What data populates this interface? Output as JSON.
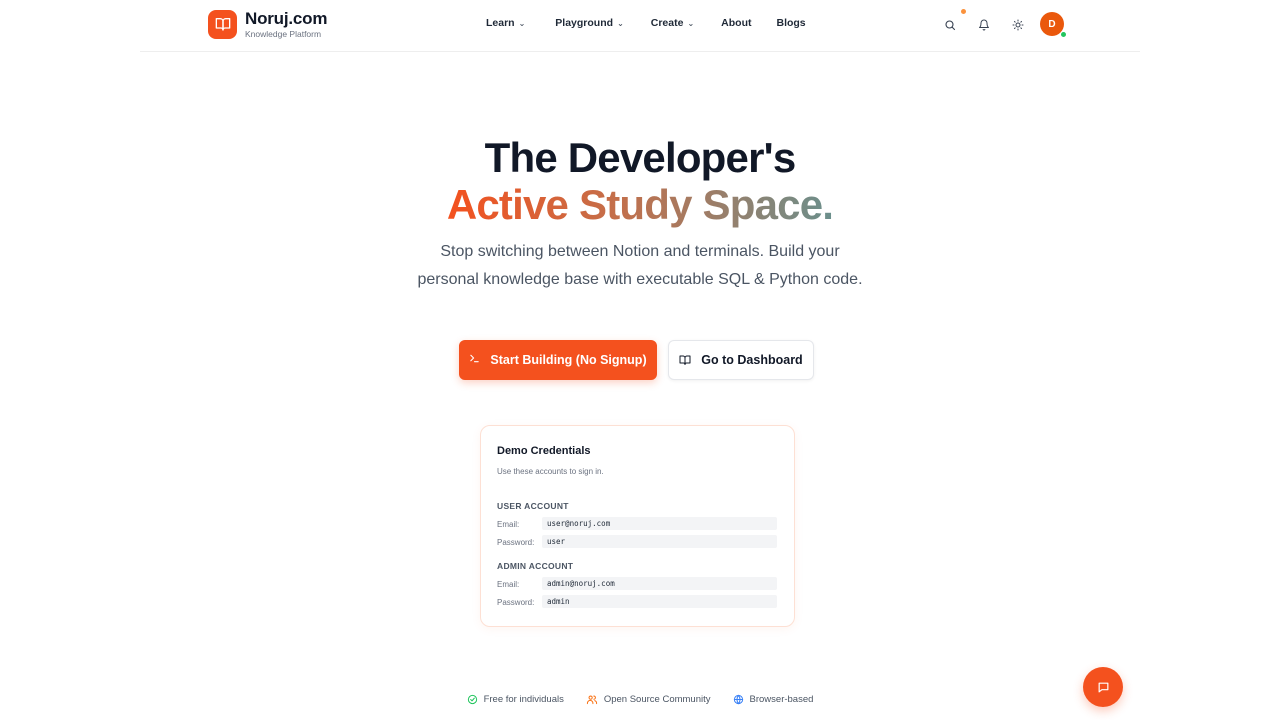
{
  "brand": {
    "name": "Noruj.com",
    "subtitle": "Knowledge Platform",
    "accent": "#f4511e"
  },
  "nav": {
    "items": [
      {
        "label": "Learn",
        "has_dropdown": true
      },
      {
        "label": "Playground",
        "has_dropdown": true
      },
      {
        "label": "Create",
        "has_dropdown": true
      },
      {
        "label": "About",
        "has_dropdown": false
      },
      {
        "label": "Blogs",
        "has_dropdown": false
      }
    ]
  },
  "header_actions": {
    "icons": [
      "search-icon",
      "bell-icon",
      "sun-icon"
    ],
    "avatar_initial": "D",
    "online_status_color": "#22c55e"
  },
  "hero": {
    "title_line1": "The Developer's",
    "title_line2": "Active Study Space.",
    "subtitle": "Stop switching between Notion and terminals. Build your personal knowledge base with executable SQL & Python code.",
    "primary_button": "Start Building (No Signup)",
    "secondary_button": "Go to Dashboard"
  },
  "credentials": {
    "title": "Demo Credentials",
    "description": "Use these accounts to sign in.",
    "user": {
      "section": "USER ACCOUNT",
      "email_label": "Email:",
      "email": "user@noruj.com",
      "password_label": "Password:",
      "password": "user"
    },
    "admin": {
      "section": "ADMIN ACCOUNT",
      "email_label": "Email:",
      "email": "admin@noruj.com",
      "password_label": "Password:",
      "password": "admin"
    }
  },
  "features": [
    {
      "label": "Free for individuals",
      "icon": "check-circle-icon",
      "color": "#22c55e"
    },
    {
      "label": "Open Source Community",
      "icon": "users-icon",
      "color": "#f97316"
    },
    {
      "label": "Browser-based",
      "icon": "globe-icon",
      "color": "#3b82f6"
    }
  ],
  "chat": {
    "icon": "chat-icon"
  }
}
